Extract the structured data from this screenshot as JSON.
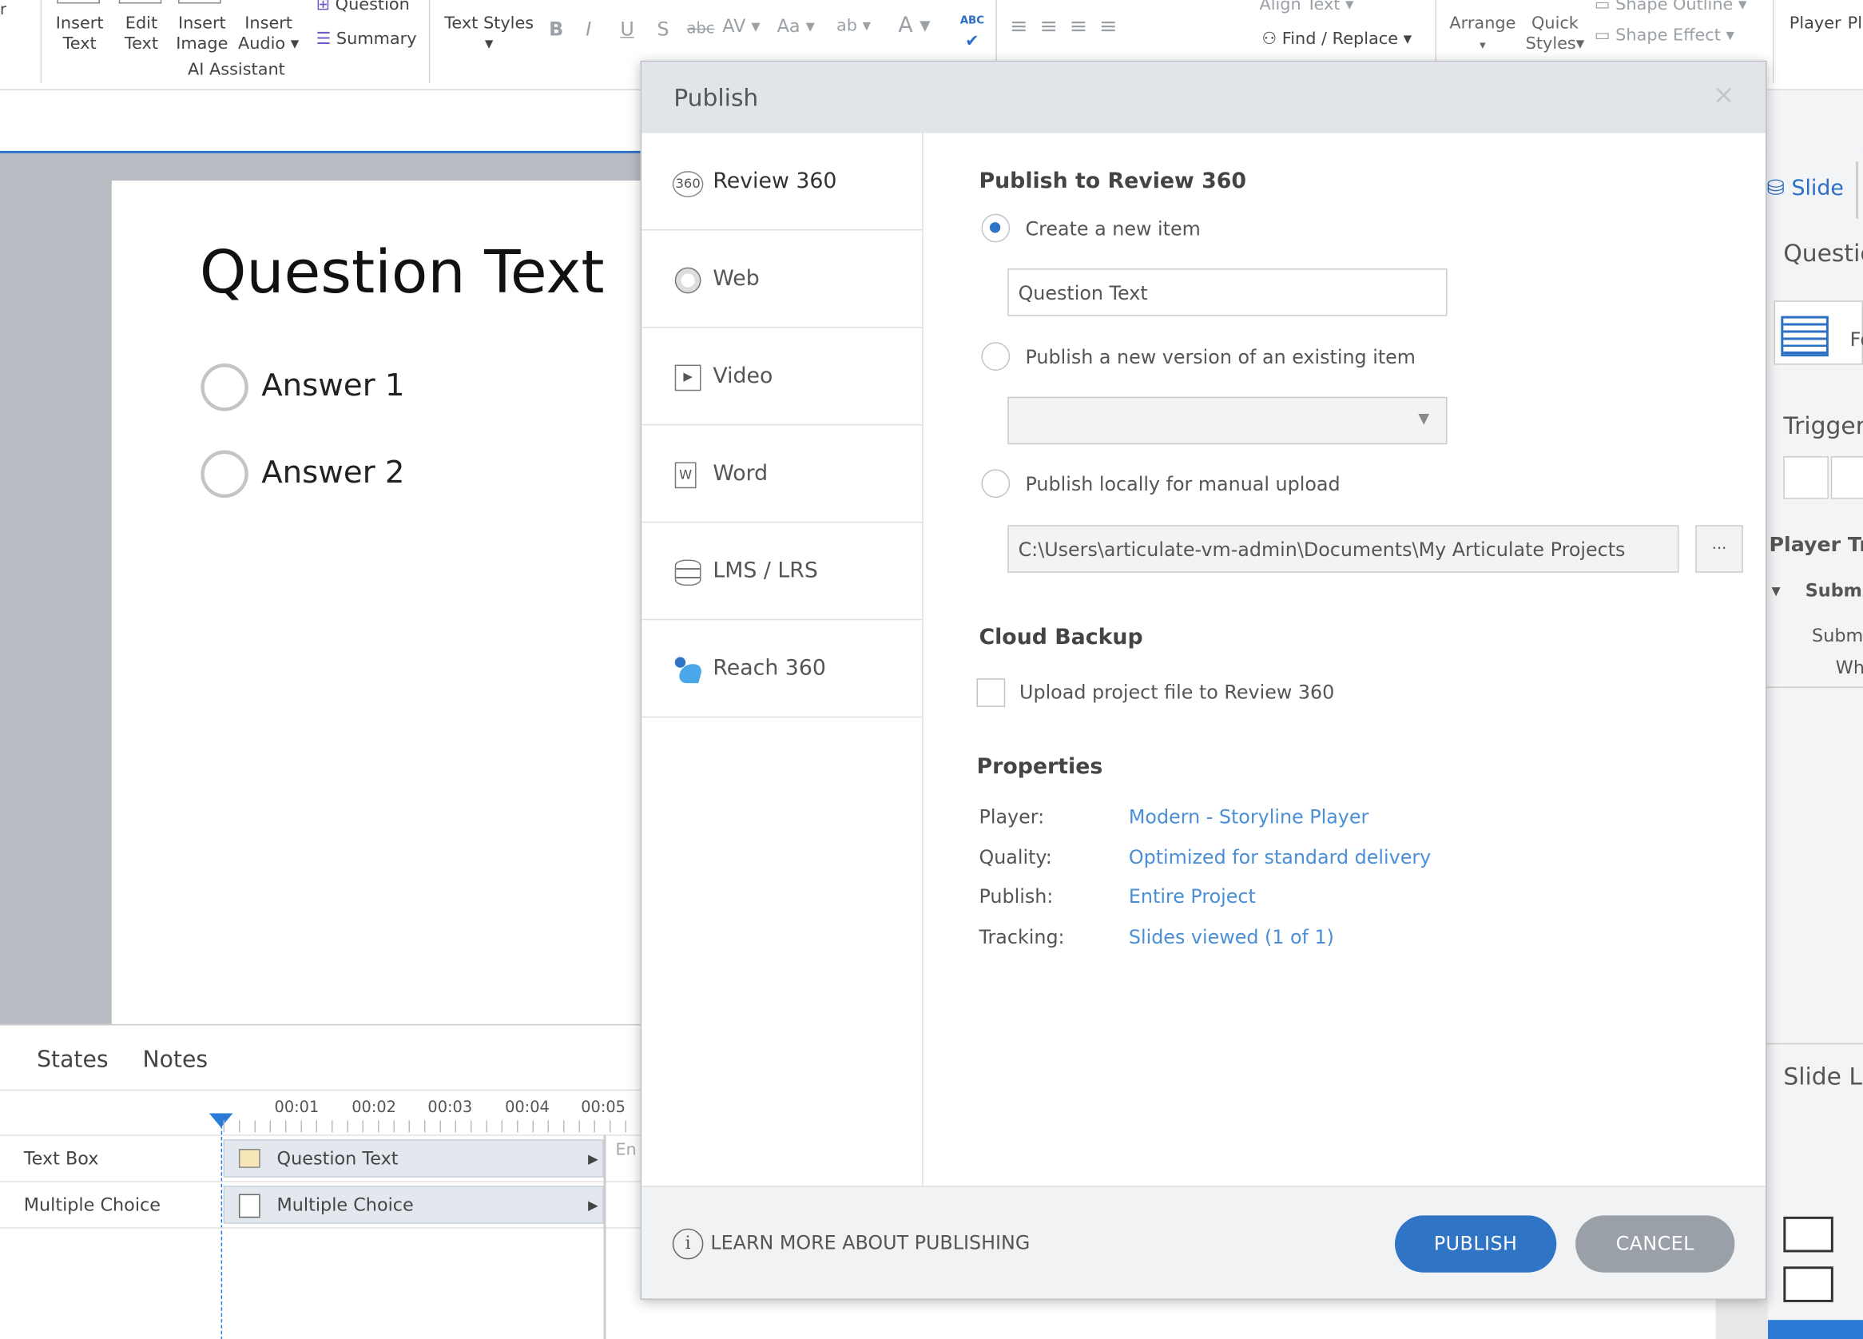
{
  "ribbon": {
    "insert_text": [
      "Insert",
      "Text"
    ],
    "edit_text": [
      "Edit",
      "Text"
    ],
    "insert_image": [
      "Insert",
      "Image"
    ],
    "insert_audio": [
      "Insert",
      "Audio"
    ],
    "question": "Question",
    "summary": "Summary",
    "group_ai": "AI Assistant",
    "text_styles": "Text Styles",
    "find_replace": "Find / Replace",
    "align_text": "Align Text",
    "arrange": "Arrange",
    "quick_styles": [
      "Quick",
      "Styles"
    ],
    "shape_outline": "Shape Outline",
    "shape_effect": "Shape Effect",
    "player": "Player",
    "player_cut": "Pl"
  },
  "slide": {
    "title": "Question Text",
    "answers": [
      "Answer 1",
      "Answer 2"
    ]
  },
  "bottom": {
    "tabs": [
      "States",
      "Notes"
    ],
    "ticks": [
      "00:01",
      "00:02",
      "00:03",
      "00:04",
      "00:05"
    ],
    "rows": [
      {
        "name": "Text Box",
        "bar": "Question Text"
      },
      {
        "name": "Multiple Choice",
        "bar": "Multiple Choice"
      }
    ],
    "end_cut": "En"
  },
  "right_panel": {
    "slide_tab": "Slide",
    "question_cut": "Questic",
    "trigger_cut": "Trigger",
    "player_trig_cut": "Player Tri",
    "submit_cut": "Subm",
    "submit2_cut": "Subm",
    "when_cut": "Wh",
    "slide_layers_cut": "Slide La",
    "fo_cut": "Fo"
  },
  "dialog": {
    "title": "Publish",
    "close": "×",
    "nav": [
      "Review 360",
      "Web",
      "Video",
      "Word",
      "LMS / LRS",
      "Reach 360"
    ],
    "section_title": "Publish to Review 360",
    "opt_new": "Create a new item",
    "new_item_value": "Question Text",
    "opt_version": "Publish a new version of an existing item",
    "opt_local": "Publish locally for manual upload",
    "local_path": "C:\\Users\\articulate-vm-admin\\Documents\\My Articulate Projects",
    "browse": "...",
    "cloud_title": "Cloud Backup",
    "cloud_upload": "Upload project file to Review 360",
    "props_title": "Properties",
    "props": [
      {
        "key": "Player:",
        "value": "Modern - Storyline Player"
      },
      {
        "key": "Quality:",
        "value": "Optimized for standard delivery"
      },
      {
        "key": "Publish:",
        "value": "Entire Project"
      },
      {
        "key": "Tracking:",
        "value": "Slides viewed (1 of 1)"
      }
    ],
    "learn_more": "LEARN MORE ABOUT PUBLISHING",
    "publish_btn": "PUBLISH",
    "cancel_btn": "CANCEL"
  },
  "colors": {
    "accent": "#2f74c5",
    "link": "#4a8fd6",
    "cancel": "#9aa0a8"
  }
}
